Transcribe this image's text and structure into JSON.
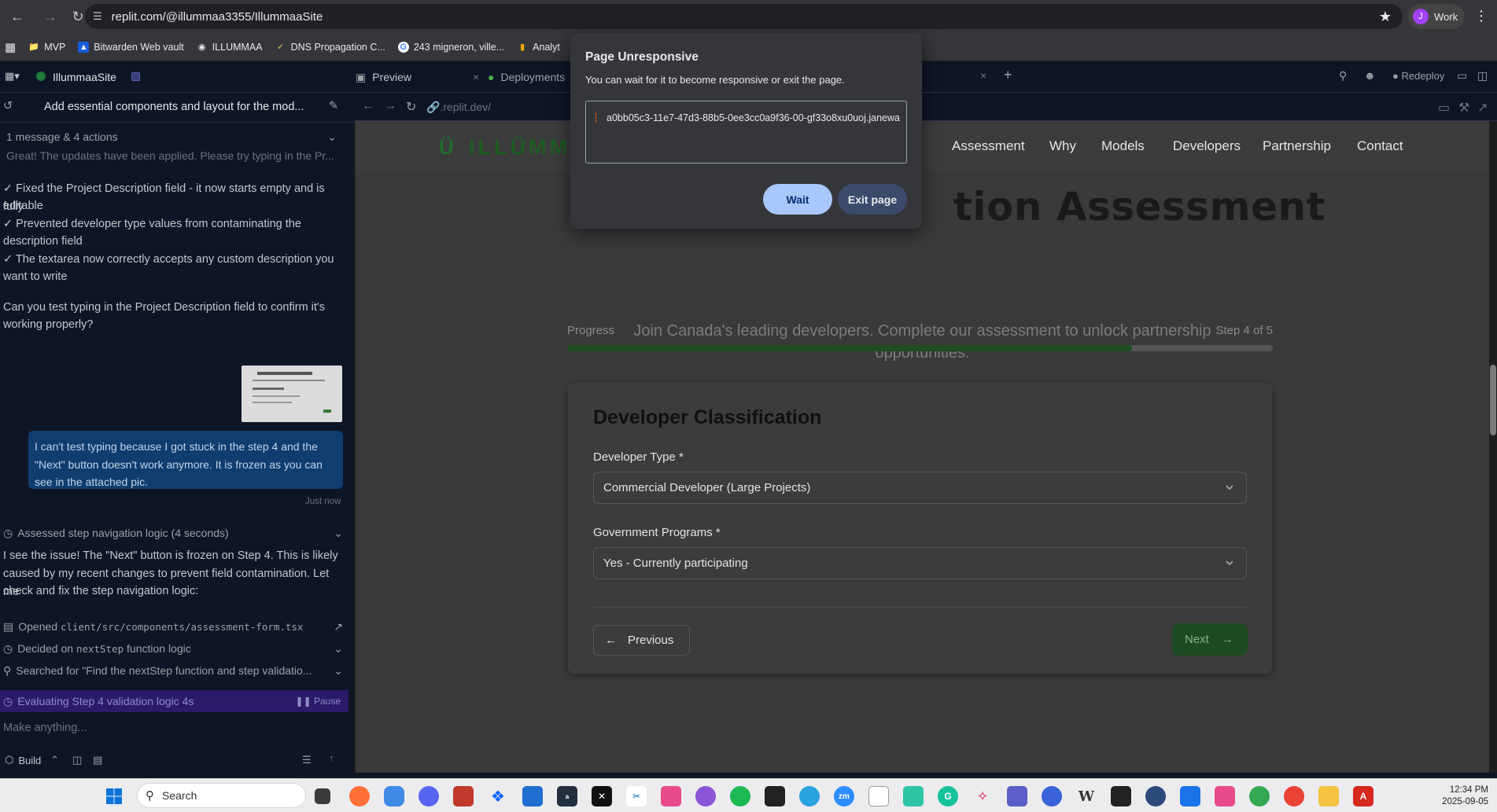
{
  "browser": {
    "url": "replit.com/@illummaa3355/IllummaaSite",
    "profile_label": "Work",
    "profile_initial": "J",
    "bookmarks": [
      "MVP",
      "Bitwarden Web vault",
      "ILLUMMAA",
      "DNS Propagation C...",
      "243 migneron, ville...",
      "Analyt"
    ]
  },
  "replit": {
    "project_name": "IllummaaSite",
    "tabs": [
      "Preview",
      "Deployments"
    ],
    "redeploy_label": "Redeploy",
    "preview_url": ".replit.dev/"
  },
  "chat": {
    "title": "Add essential components and layout for the mod...",
    "summary": "1 message & 4 actions",
    "summary_preview": "Great! The updates have been applied. Please try typing in the Pr...",
    "check_lines": [
      "✓ Fixed the Project Description field - it now starts empty and is fully",
      "editable",
      "✓ Prevented developer type values from contaminating the",
      "description field",
      "✓ The textarea now correctly accepts any custom description you",
      "want to write"
    ],
    "question_lines": [
      "Can you test typing in the Project Description field to confirm it's",
      "working properly?"
    ],
    "user_message_lines": [
      "I can't test typing because I got stuck in the step 4 and the",
      "\"Next\" button doesn't work anymore. It is frozen as you can",
      "see in the attached pic."
    ],
    "user_message_time": "Just now",
    "assessed_label": "Assessed step navigation logic (4 seconds)",
    "reply_lines": [
      "I see the issue! The \"Next\" button is frozen on Step 4. This is likely",
      "caused by my recent changes to prevent field contamination. Let me",
      "check and fix the step navigation logic:"
    ],
    "actions": [
      {
        "prefix": "Opened ",
        "code": "client/src/components/assessment-form.tsx"
      },
      {
        "prefix": "Decided on ",
        "code": "nextStep",
        "suffix": " function logic"
      },
      {
        "prefix": "Searched for \"Find the nextStep function and step validatio...",
        "code": ""
      }
    ],
    "evaluating_label": "Evaluating Step 4 validation logic 4s",
    "pause_label": "Pause",
    "input_placeholder": "Make anything...",
    "build_label": "Build"
  },
  "site": {
    "logo_text": "ILLÜMM",
    "nav": [
      "Assessment",
      "Why",
      "Models",
      "Developers",
      "Partnership",
      "Contact"
    ],
    "hero_title": "tion Assessment",
    "hero_sub_line1": "Join Canada's leading developers. Complete our assessment to unlock partnership",
    "hero_sub_line2": "opportunities.",
    "progress_label": "Progress",
    "progress_step": "Step 4 of 5",
    "progress_fraction": 0.8,
    "card_title": "Developer Classification",
    "developer_type_label": "Developer Type *",
    "developer_type_value": "Commercial Developer (Large Projects)",
    "gov_programs_label": "Government Programs *",
    "gov_programs_value": "Yes - Currently participating",
    "previous_label": "Previous",
    "next_label": "Next"
  },
  "dialog": {
    "title": "Page Unresponsive",
    "message": "You can wait for it to become responsive or exit the page.",
    "page_id": "a0bb05c3-11e7-47d3-88b5-0ee3cc0a9f36-00-gf33o8xu0uoj.janewa",
    "wait_label": "Wait",
    "exit_label": "Exit page"
  },
  "taskbar": {
    "search_label": "Search",
    "time": "12:34 PM",
    "date": "2025-09-05"
  },
  "colors": {
    "accent_green": "#1f5c24",
    "dialog_wait": "#a8c7fa",
    "dialog_exit": "#3b4a6b",
    "eval_bar": "#2c1a6b"
  }
}
